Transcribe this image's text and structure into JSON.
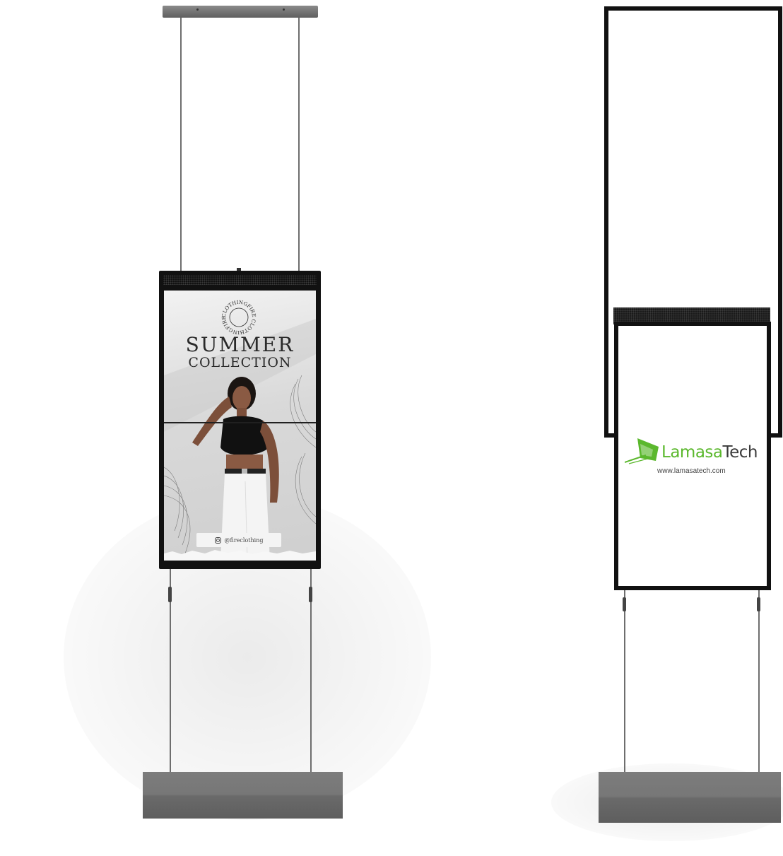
{
  "scene": {
    "left_display": {
      "badge_ring_text": "CLOTHINGFIRE CLOTHINGFIRE",
      "title_line1": "SUMMER",
      "title_line2": "COLLECTION",
      "social_handle": "@fireclothing"
    },
    "right_display": {
      "brand_prefix": "Lamasa",
      "brand_suffix": "Tech",
      "website": "www.lamasatech.com"
    }
  },
  "colors": {
    "brand_green": "#5bb82d",
    "frame_black": "#111111",
    "base_grey": "#777777"
  },
  "icons": [
    "instagram-icon",
    "lamasatech-logo-icon"
  ]
}
